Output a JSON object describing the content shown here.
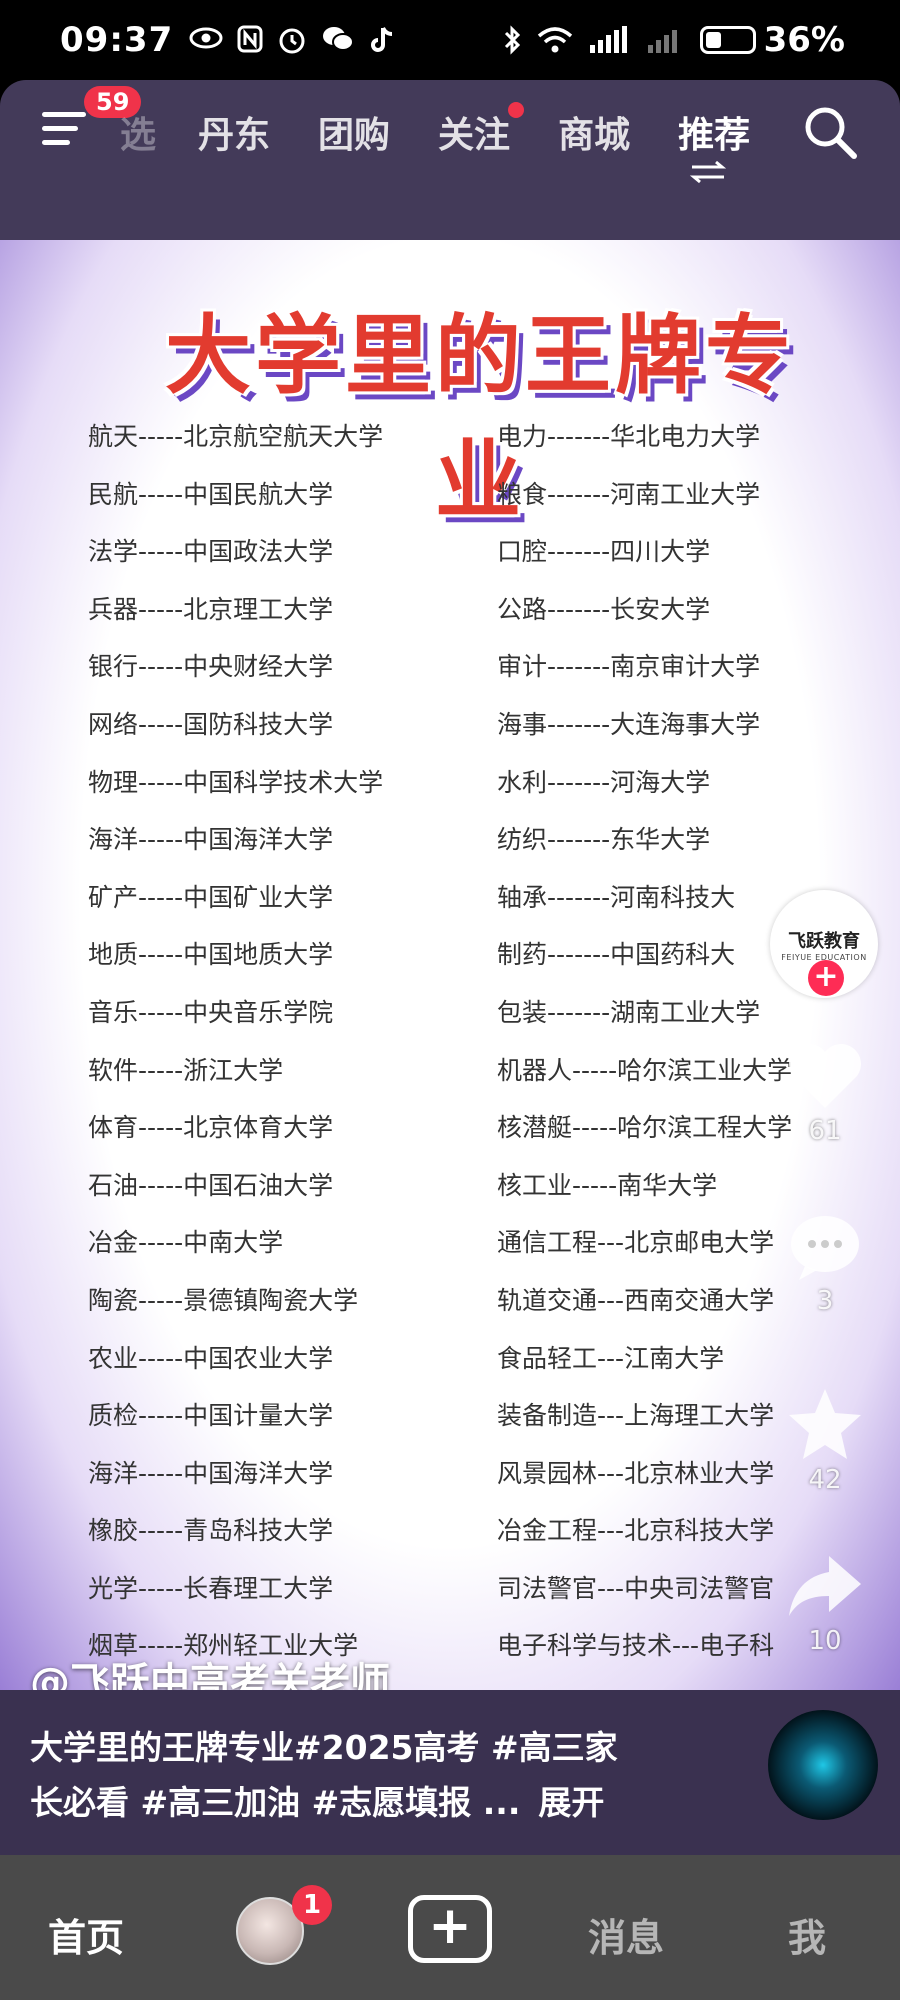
{
  "status_bar": {
    "time": "09:37",
    "battery": "36%",
    "battery_level": 0.36,
    "icons_left": [
      "eye-icon",
      "nfc-icon",
      "alarm-icon",
      "wechat-icon",
      "tiktok-icon"
    ],
    "icons_right": [
      "bluetooth-icon",
      "wifi-icon",
      "signal-5g-icon",
      "signal-icon"
    ]
  },
  "top_nav": {
    "menu_badge": "59",
    "tabs": [
      {
        "label": "选"
      },
      {
        "label": "丹东"
      },
      {
        "label": "团购"
      },
      {
        "label": "关注"
      },
      {
        "label": "商城"
      },
      {
        "label": "推荐"
      }
    ],
    "active_tab": "推荐"
  },
  "poster": {
    "title": "大学里的王牌专业",
    "left_column": [
      "航天-----北京航空航天大学",
      "民航-----中国民航大学",
      "法学-----中国政法大学",
      "兵器-----北京理工大学",
      "银行-----中央财经大学",
      "网络-----国防科技大学",
      "物理-----中国科学技术大学",
      "海洋-----中国海洋大学",
      "矿产-----中国矿业大学",
      "地质-----中国地质大学",
      "音乐-----中央音乐学院",
      "软件-----浙江大学",
      "体育-----北京体育大学",
      "石油-----中国石油大学",
      "冶金-----中南大学",
      "陶瓷-----景德镇陶瓷大学",
      "农业-----中国农业大学",
      "质检-----中国计量大学",
      "海洋-----中国海洋大学",
      "橡胶-----青岛科技大学",
      "光学-----长春理工大学",
      "烟草-----郑州轻工业大学"
    ],
    "right_column": [
      "电力-------华北电力大学",
      "粮食-------河南工业大学",
      "口腔-------四川大学",
      "公路-------长安大学",
      "审计-------南京审计大学",
      "海事-------大连海事大学",
      "水利-------河海大学",
      "纺织-------东华大学",
      "轴承-------河南科技大",
      "制药-------中国药科大",
      "包装-------湖南工业大学",
      "机器人-----哈尔滨工业大学",
      "核潜艇-----哈尔滨工程大学",
      "核工业-----南华大学",
      "通信工程---北京邮电大学",
      "轨道交通---西南交通大学",
      "食品轻工---江南大学",
      "装备制造---上海理工大学",
      "风景园林---北京林业大学",
      "冶金工程---北京科技大学",
      "司法警官---中央司法警官",
      "电子科学与技术---电子科"
    ]
  },
  "rail": {
    "logo_text": "飞跃教育",
    "logo_sub": "FEIYUE EDUCATION",
    "likes": "61",
    "comments": "3",
    "favorites": "42",
    "shares": "10"
  },
  "video_info": {
    "author": "@飞跃中高考关老师",
    "description_line1": "大学里的王牌专业#2025高考 #高三家",
    "description_line2": "长必看 #高三加油 #志愿填报 ...",
    "expand": "展开"
  },
  "bottom_nav": {
    "home": "首页",
    "friend_badge": "1",
    "messages": "消息",
    "me": "我"
  },
  "colors": {
    "accent_red": "#f0334a",
    "title_red": "#e23b2f",
    "panel_purple": "#433a59"
  }
}
